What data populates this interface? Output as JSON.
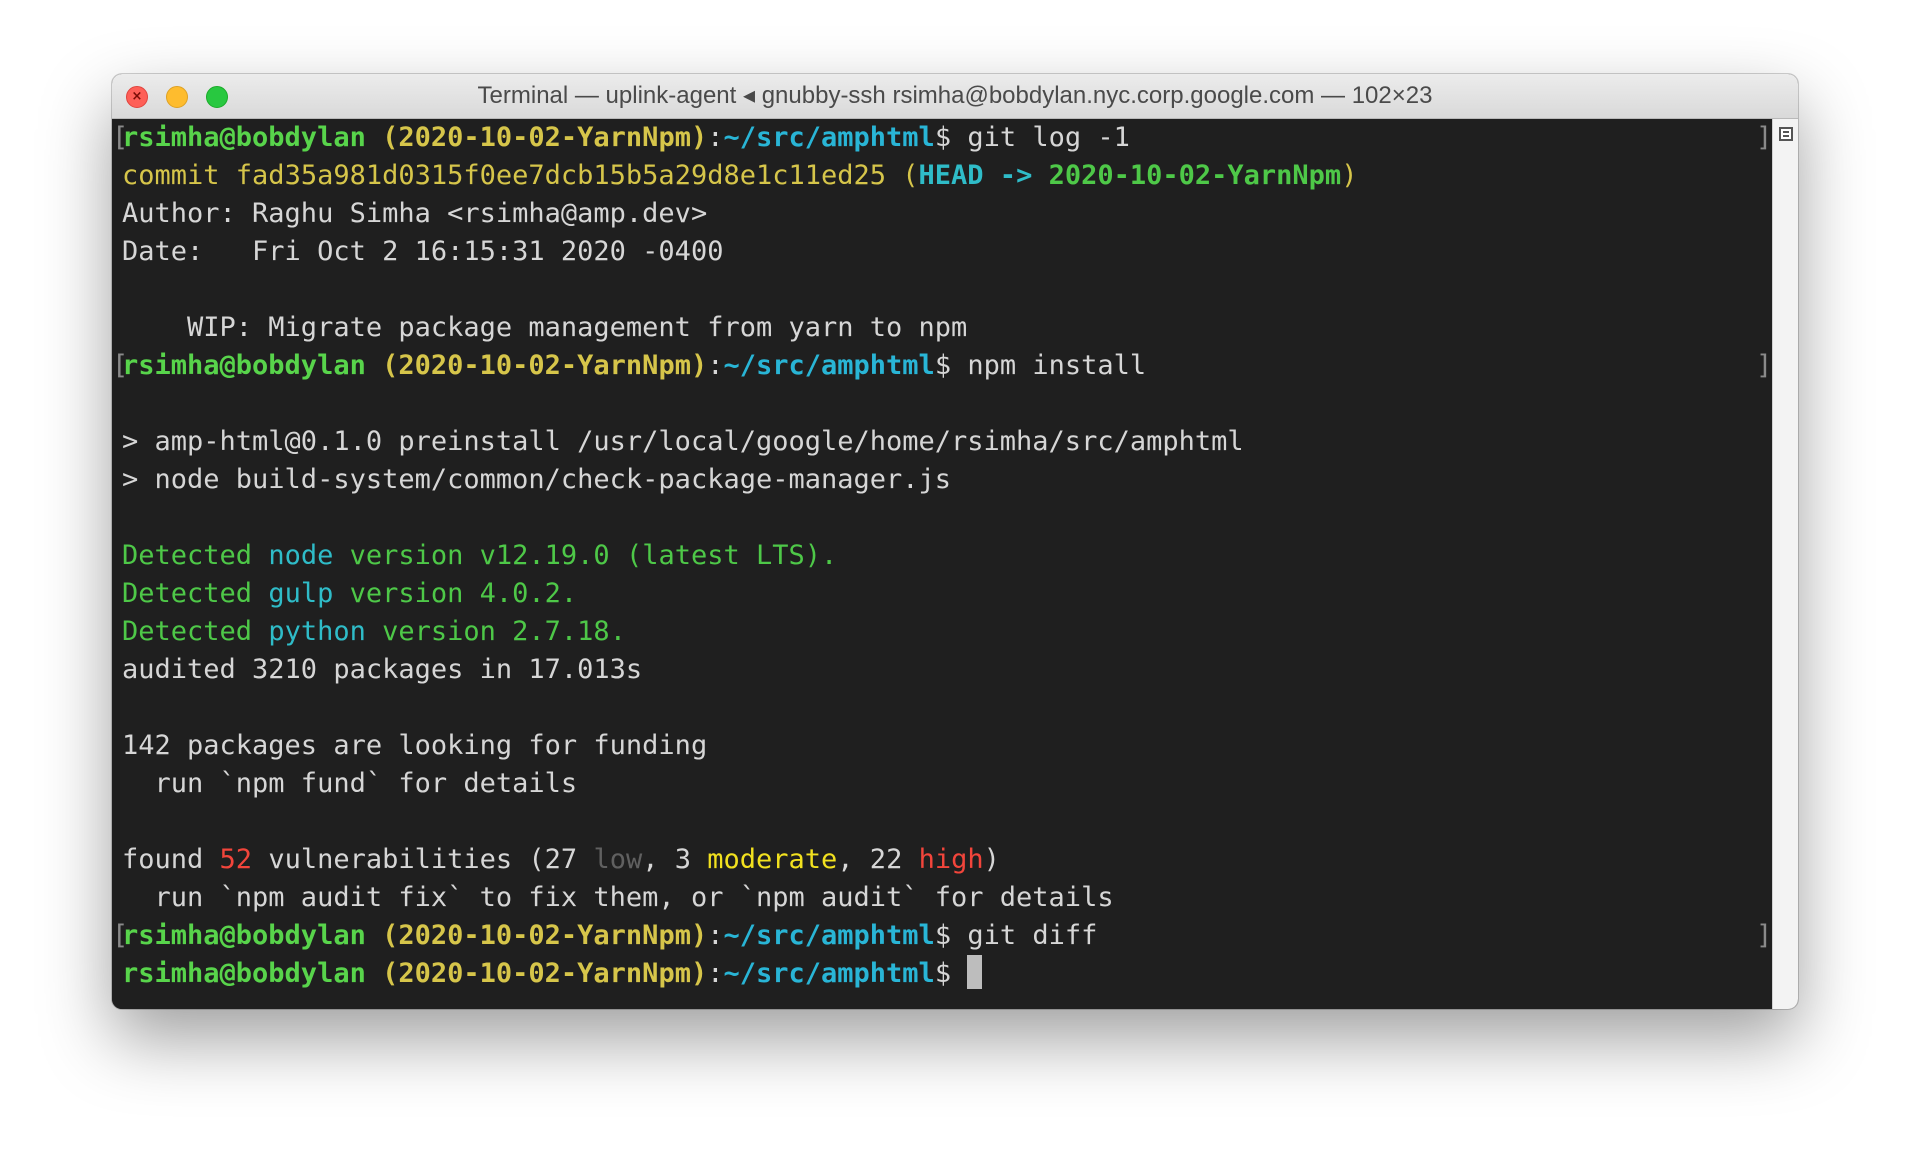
{
  "window": {
    "title": "Terminal — uplink-agent ◂ gnubby-ssh rsimha@bobdylan.nyc.corp.google.com — 102×23",
    "buttons": [
      "close",
      "minimize",
      "zoom"
    ],
    "close_glyph": "×"
  },
  "prompt": {
    "user": "rsimha@bobdylan",
    "branch": " (2020-10-02-YarnNpm)",
    "colon": ":",
    "path": "~/src/amphtml",
    "dollar": "$ "
  },
  "brackets": {
    "open": "[",
    "close": "]"
  },
  "commands": {
    "c1": "git log -1",
    "c2": "npm install",
    "c3": "git diff"
  },
  "gitlog": {
    "commit_prefix": "commit ",
    "hash": "fad35a981d0315f0ee7dcb15b5a29d8e1c11ed25",
    "paren_open": " (",
    "head": "HEAD -> ",
    "ref": "2020-10-02-YarnNpm",
    "paren_close": ")",
    "author": "Author: Raghu Simha <rsimha@amp.dev>",
    "date": "Date:   Fri Oct 2 16:15:31 2020 -0400",
    "message": "    WIP: Migrate package management from yarn to npm"
  },
  "npm": {
    "pre1": "> amp-html@0.1.0 preinstall /usr/local/google/home/rsimha/src/amphtml",
    "pre2": "> node build-system/common/check-package-manager.js",
    "detected": "Detected ",
    "node_name": "node",
    "node_ver": " version v12.19.0 (latest LTS).",
    "gulp_name": "gulp",
    "gulp_ver": " version 4.0.2.",
    "python_name": "python",
    "python_ver": " version 2.7.18.",
    "audited": "audited 3210 packages in 17.013s",
    "funding": "142 packages are looking for funding",
    "fund_hint": "  run `npm fund` for details",
    "found": "found ",
    "vuln_count": "52",
    "vuln_mid": " vulnerabilities (27 ",
    "low": "low",
    "comma1": ", 3 ",
    "moderate": "moderate",
    "comma2": ", 22 ",
    "high": "high",
    "close": ")",
    "audit_hint": "  run `npm audit fix` to fix them, or `npm audit` for details"
  },
  "colors": {
    "background": "#1f1f1f",
    "prompt_user": "#58d44b",
    "prompt_branch": "#d6c54a",
    "prompt_path": "#29b5d6",
    "detected": "#4ec848",
    "version_info": "#2fbcc8",
    "vuln_count": "#f2453b",
    "low": "#606060",
    "moderate": "#f2e11f",
    "high": "#f2453b"
  }
}
